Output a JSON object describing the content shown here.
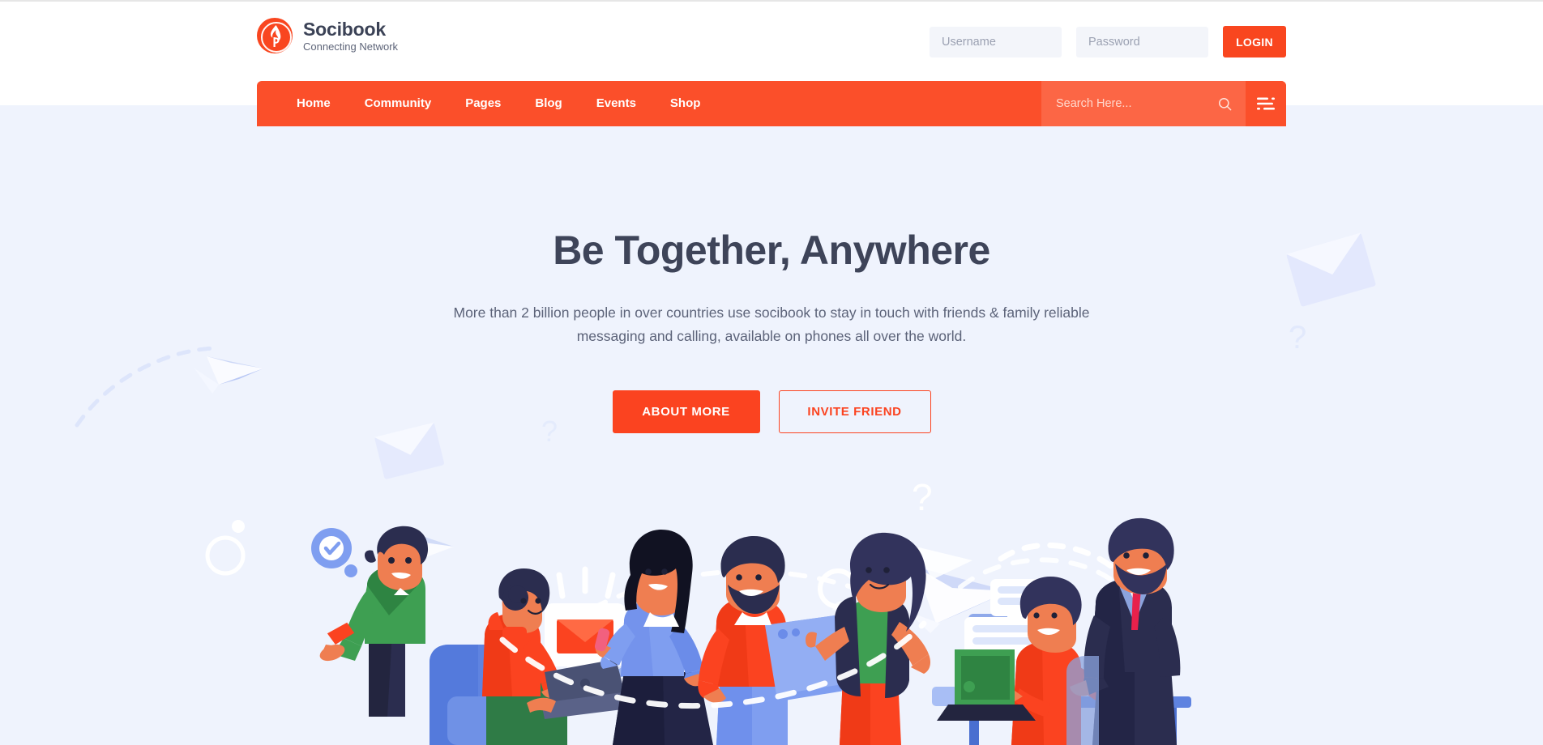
{
  "brand": {
    "name": "Socibook",
    "tagline": "Connecting Network",
    "logo_icon": "flame-circle-logo",
    "color": "#f9461f"
  },
  "auth": {
    "username_placeholder": "Username",
    "username_value": "",
    "password_placeholder": "Password",
    "password_value": "",
    "login_label": "LOGIN"
  },
  "nav": {
    "background": "#fb4f2a",
    "items": [
      {
        "label": "Home",
        "name": "nav-item-home"
      },
      {
        "label": "Community",
        "name": "nav-item-community"
      },
      {
        "label": "Pages",
        "name": "nav-item-pages"
      },
      {
        "label": "Blog",
        "name": "nav-item-blog"
      },
      {
        "label": "Events",
        "name": "nav-item-events"
      },
      {
        "label": "Shop",
        "name": "nav-item-shop"
      }
    ],
    "search": {
      "placeholder": "Search Here...",
      "value": "",
      "icon": "search-icon"
    },
    "menu_icon": "hamburger-menu-icon"
  },
  "hero": {
    "title": "Be Together, Anywhere",
    "subtitle": "More than 2 billion people in over countries use socibook to stay in touch with friends & family reliable messaging and calling, available on phones all over the world.",
    "primary_button": "ABOUT MORE",
    "secondary_button": "INVITE FRIEND",
    "background": "#eff3fd",
    "title_color": "#3e4459",
    "accent": "#fb4320",
    "illustration": "people-connecting-flat-illustration"
  }
}
